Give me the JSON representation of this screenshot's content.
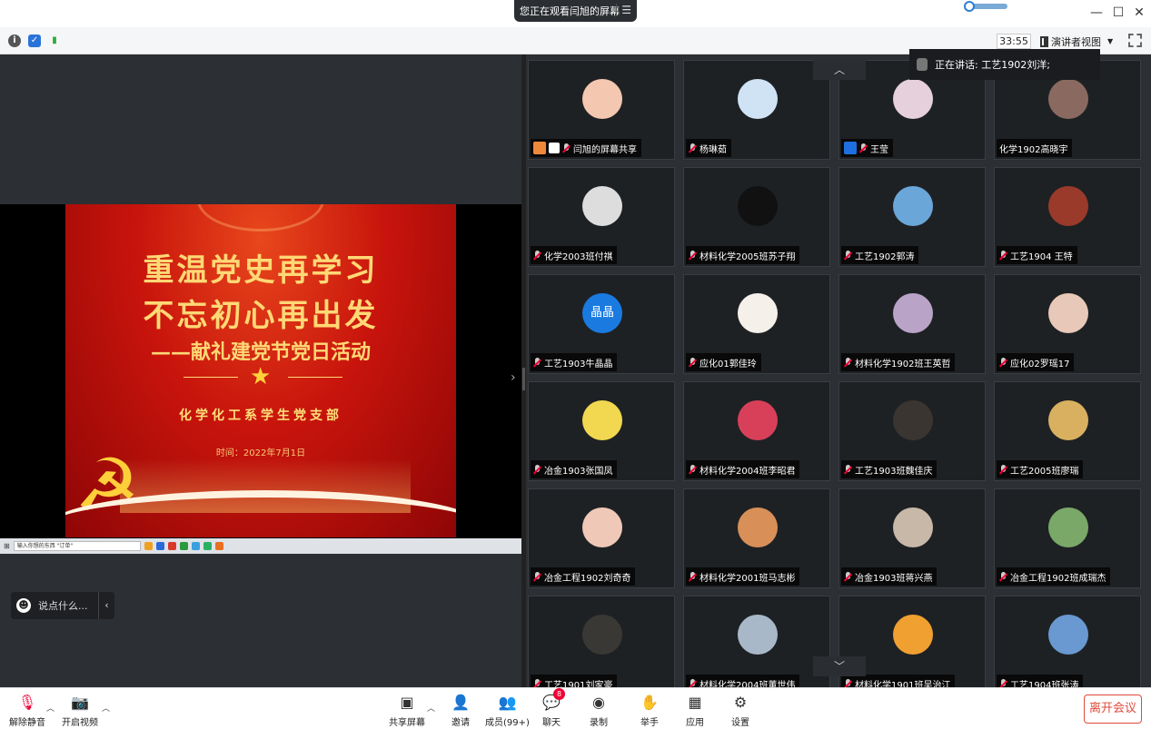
{
  "window": {
    "share_banner": "您正在观看闫旭的屏幕",
    "timer": "33:55",
    "presenter_view": "演讲者视图"
  },
  "slide": {
    "title_line1": "重温党史再学习",
    "title_line2": "不忘初心再出发",
    "subtitle": "——献礼建党节党日活动",
    "org": "化学化工系学生党支部",
    "date": "时间：2022年7月1日",
    "taskbar_search": "输入你想的东西 \"订单\""
  },
  "chat": {
    "placeholder": "说点什么..."
  },
  "speaking": {
    "label": "正在讲话: 工艺1902刘洋;"
  },
  "participants": [
    {
      "name": "闫旭的屏幕共享",
      "host": true,
      "color": "#f4c7b0"
    },
    {
      "name": "杨琳茹",
      "color": "#cfe3f5"
    },
    {
      "name": "王莹",
      "user": true,
      "color": "#e6d0dc"
    },
    {
      "name": "化学1902高晓宇",
      "nomic": true,
      "color": "#8a6a60"
    },
    {
      "name": "化学2003班付祺",
      "color": "#ddd"
    },
    {
      "name": "材料化学2005班苏子翔",
      "color": "#111"
    },
    {
      "name": "工艺1902郭涛",
      "color": "#6aa6d8"
    },
    {
      "name": "工艺1904 王特",
      "color": "#9a3a2a"
    },
    {
      "name": "工艺1903牛晶晶",
      "color": "#1a7ae0",
      "initials": "晶晶"
    },
    {
      "name": "应化01郭佳玲",
      "color": "#f5f0ea"
    },
    {
      "name": "材料化学1902班王英哲",
      "color": "#b9a4c8"
    },
    {
      "name": "应化02罗瑶17",
      "color": "#e8c8b8"
    },
    {
      "name": "冶金1903张国凤",
      "color": "#f2d850"
    },
    {
      "name": "材料化学2004班李昭君",
      "color": "#d8405a"
    },
    {
      "name": "工艺1903班魏佳庆",
      "color": "#3a3530"
    },
    {
      "name": "工艺2005班廖瑞",
      "color": "#d8b060"
    },
    {
      "name": "冶金工程1902刘奇奇",
      "color": "#f0c8b8"
    },
    {
      "name": "材料化学2001班马志彬",
      "color": "#d89058"
    },
    {
      "name": "冶金1903班蒋兴燕",
      "color": "#c8b8a8"
    },
    {
      "name": "冶金工程1902班成瑞杰",
      "color": "#7aa868"
    },
    {
      "name": "工艺1901刘家豪",
      "color": "#3a3835"
    },
    {
      "name": "材料化学2004班董世伟",
      "color": "#a8b8c8"
    },
    {
      "name": "材料化学1901班吴治江",
      "color": "#f0a030"
    },
    {
      "name": "工艺1904班张涛",
      "color": "#6a98d0"
    }
  ],
  "toolbar": {
    "unmute": "解除静音",
    "start_video": "开启视频",
    "share_screen": "共享屏幕",
    "invite": "邀请",
    "members": "成员(99+)",
    "chat": "聊天",
    "chat_badge": "8",
    "record": "录制",
    "raise_hand": "举手",
    "apps": "应用",
    "settings": "设置",
    "leave": "离开会议"
  }
}
